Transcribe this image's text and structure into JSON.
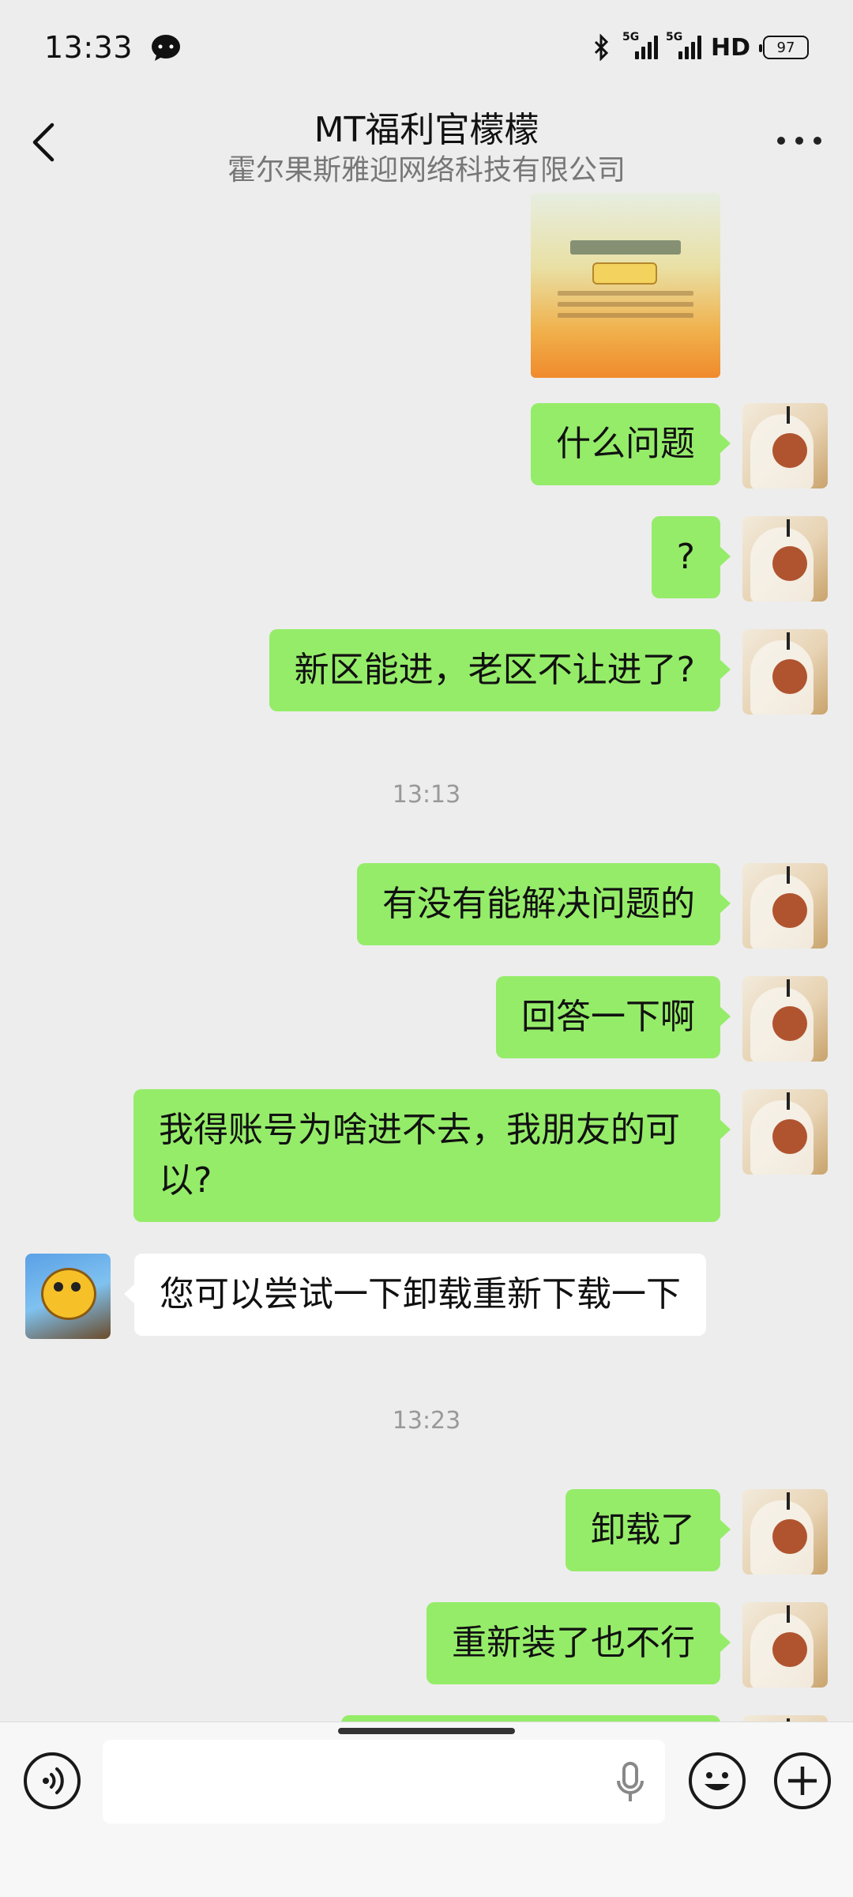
{
  "status_bar": {
    "time": "13:33",
    "network_1": "5G",
    "network_2": "5G",
    "hd": "HD",
    "battery": "97"
  },
  "header": {
    "title": "MT福利官檬檬",
    "subtitle": "霍尔果斯雅迎网络科技有限公司"
  },
  "messages": [
    {
      "sender": "me",
      "text": "什么问题"
    },
    {
      "sender": "me",
      "text": "?"
    },
    {
      "sender": "me",
      "text": "新区能进，老区不让进了?"
    },
    {
      "type": "timestamp",
      "text": "13:13"
    },
    {
      "sender": "me",
      "text": "有没有能解决问题的"
    },
    {
      "sender": "me",
      "text": "回答一下啊"
    },
    {
      "sender": "me",
      "text": "我得账号为啥进不去，我朋友的可以?"
    },
    {
      "sender": "them",
      "text": "您可以尝试一下卸载重新下载一下"
    },
    {
      "type": "timestamp",
      "text": "13:23"
    },
    {
      "sender": "me",
      "text": "卸载了"
    },
    {
      "sender": "me",
      "text": "重新装了也不行"
    }
  ],
  "colors": {
    "background": "#ededed",
    "my_bubble": "#95ec69",
    "their_bubble": "#ffffff",
    "input_bar": "#f7f7f7"
  },
  "icons": {
    "back": "chevron-left-icon",
    "more": "more-dots-icon",
    "voice": "voice-icon",
    "mic": "microphone-icon",
    "emoji": "emoji-icon",
    "plus": "plus-icon"
  }
}
